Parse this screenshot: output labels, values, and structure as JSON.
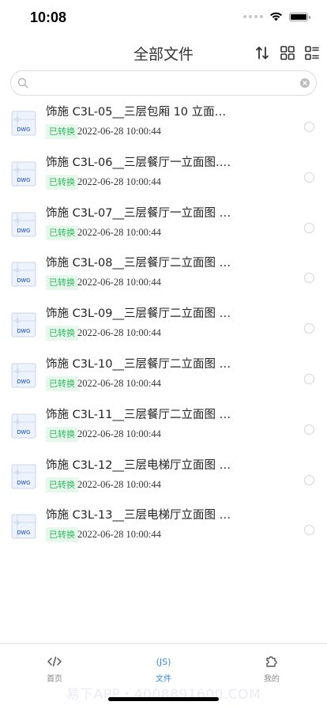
{
  "status": {
    "time": "10:08"
  },
  "header": {
    "title": "全部文件"
  },
  "search": {
    "placeholder": "",
    "value": ""
  },
  "files": [
    {
      "name": "饰施 C3L-05__三层包厢 10 立面…",
      "status": "已转换",
      "date": "2022-06-28 10:00:44",
      "type": "DWG"
    },
    {
      "name": "饰施 C3L-06__三层餐厅一立面图.…",
      "status": "已转换",
      "date": "2022-06-28 10:00:44",
      "type": "DWG"
    },
    {
      "name": "饰施 C3L-07__三层餐厅一立面图 …",
      "status": "已转换",
      "date": "2022-06-28 10:00:44",
      "type": "DWG"
    },
    {
      "name": "饰施 C3L-08__三层餐厅二立面图 …",
      "status": "已转换",
      "date": "2022-06-28 10:00:44",
      "type": "DWG"
    },
    {
      "name": "饰施 C3L-09__三层餐厅二立面图 …",
      "status": "已转换",
      "date": "2022-06-28 10:00:44",
      "type": "DWG"
    },
    {
      "name": "饰施 C3L-10__三层餐厅二立面图 …",
      "status": "已转换",
      "date": "2022-06-28 10:00:44",
      "type": "DWG"
    },
    {
      "name": "饰施 C3L-11__三层餐厅二立面图 …",
      "status": "已转换",
      "date": "2022-06-28 10:00:44",
      "type": "DWG"
    },
    {
      "name": "饰施 C3L-12__三层电梯厅立面图 …",
      "status": "已转换",
      "date": "2022-06-28 10:00:44",
      "type": "DWG"
    },
    {
      "name": "饰施 C3L-13__三层电梯厅立面图 …",
      "status": "已转换",
      "date": "2022-06-28 10:00:44",
      "type": "DWG"
    }
  ],
  "tabs": [
    {
      "label": "首页",
      "icon": "</>"
    },
    {
      "label": "文件",
      "icon": "(JS)"
    },
    {
      "label": "我的",
      "icon": "puzzle-icon"
    }
  ],
  "watermark": "易下APP・4008891600.COM",
  "colors": {
    "accent": "#2e8de6",
    "badge_text": "#2fb85d",
    "badge_bg": "#e6f7ec"
  }
}
